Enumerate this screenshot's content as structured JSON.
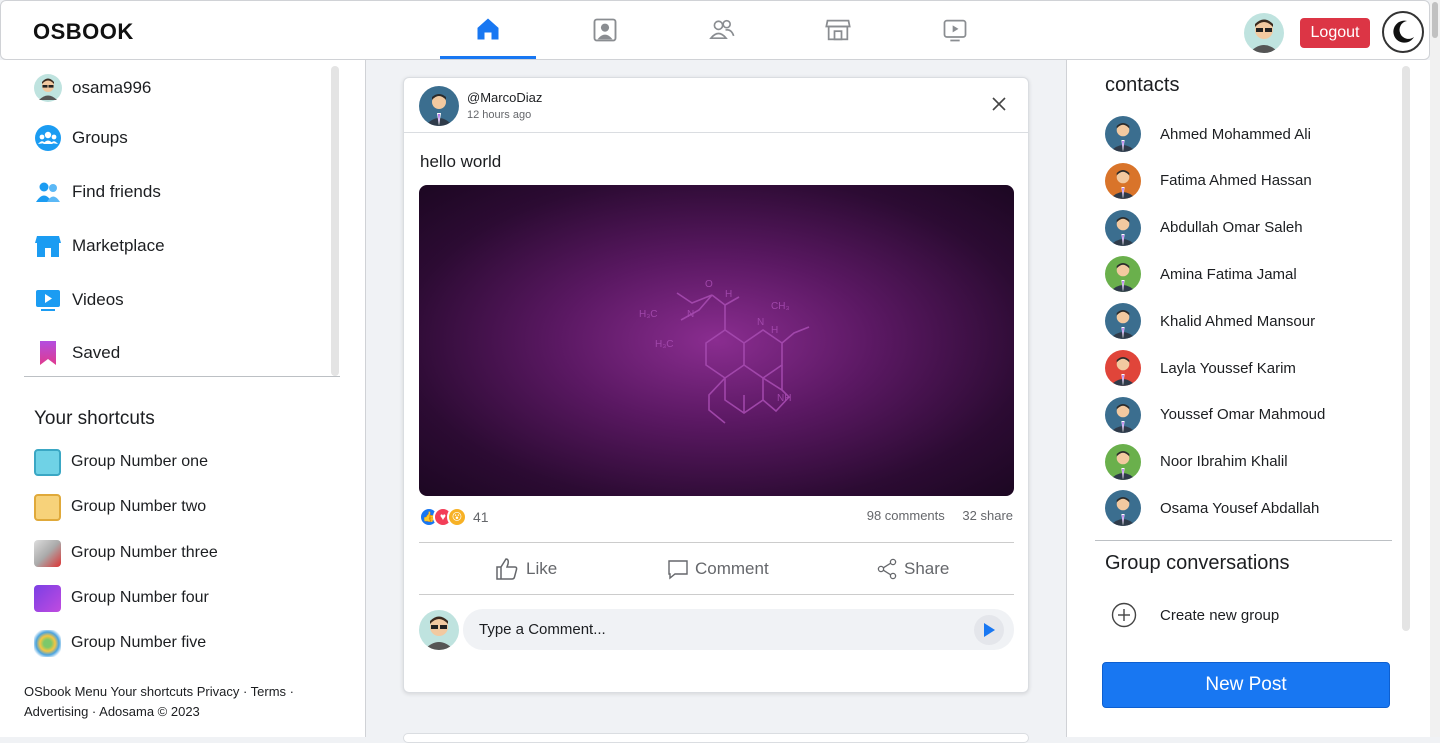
{
  "app": {
    "logo": "OSBOOK"
  },
  "nav": {
    "tabs": [
      {
        "name": "home",
        "icon": "home-icon",
        "active": true
      },
      {
        "name": "profile",
        "icon": "profile-icon",
        "active": false
      },
      {
        "name": "friends",
        "icon": "friends-icon",
        "active": false
      },
      {
        "name": "marketplace",
        "icon": "store-icon",
        "active": false
      },
      {
        "name": "videos",
        "icon": "video-icon",
        "active": false
      }
    ],
    "logout_label": "Logout"
  },
  "sidebar": {
    "items": [
      {
        "label": "osama996",
        "icon": "avatar"
      },
      {
        "label": "Groups",
        "icon": "groups-icon"
      },
      {
        "label": "Find friends",
        "icon": "find-friends-icon"
      },
      {
        "label": "Marketplace",
        "icon": "marketplace-icon"
      },
      {
        "label": "Videos",
        "icon": "videos-icon"
      },
      {
        "label": "Saved",
        "icon": "saved-icon"
      }
    ],
    "shortcuts_title": "Your shortcuts",
    "shortcuts": [
      {
        "label": "Group Number one"
      },
      {
        "label": "Group Number two"
      },
      {
        "label": "Group Number three"
      },
      {
        "label": "Group Number four"
      },
      {
        "label": "Group Number five"
      }
    ],
    "footer": "OSbook Menu Your shortcuts Privacy · Terms · Advertising · Adosama © 2023"
  },
  "post": {
    "username": "@MarcoDiaz",
    "time": "12 hours ago",
    "text": "hello world",
    "reaction_count": "41",
    "comments": "98 comments",
    "shares": "32 share",
    "like_label": "Like",
    "comment_label": "Comment",
    "share_label": "Share",
    "comment_placeholder": "Type a Comment..."
  },
  "contacts": {
    "title": "contacts",
    "list": [
      {
        "name": "Ahmed Mohammed Ali",
        "color": "#3b6e8f"
      },
      {
        "name": "Fatima Ahmed Hassan",
        "color": "#d9742a"
      },
      {
        "name": "Abdullah Omar Saleh",
        "color": "#3b6e8f"
      },
      {
        "name": "Amina Fatima Jamal",
        "color": "#6ab04c"
      },
      {
        "name": "Khalid Ahmed Mansour",
        "color": "#3b6e8f"
      },
      {
        "name": "Layla Youssef Karim",
        "color": "#e0453a"
      },
      {
        "name": "Youssef Omar Mahmoud",
        "color": "#3b6e8f"
      },
      {
        "name": "Noor Ibrahim Khalil",
        "color": "#6ab04c"
      },
      {
        "name": "Osama Yousef Abdallah",
        "color": "#3b6e8f"
      }
    ],
    "group_title": "Group conversations",
    "create_group": "Create new group",
    "new_post": "New Post"
  }
}
